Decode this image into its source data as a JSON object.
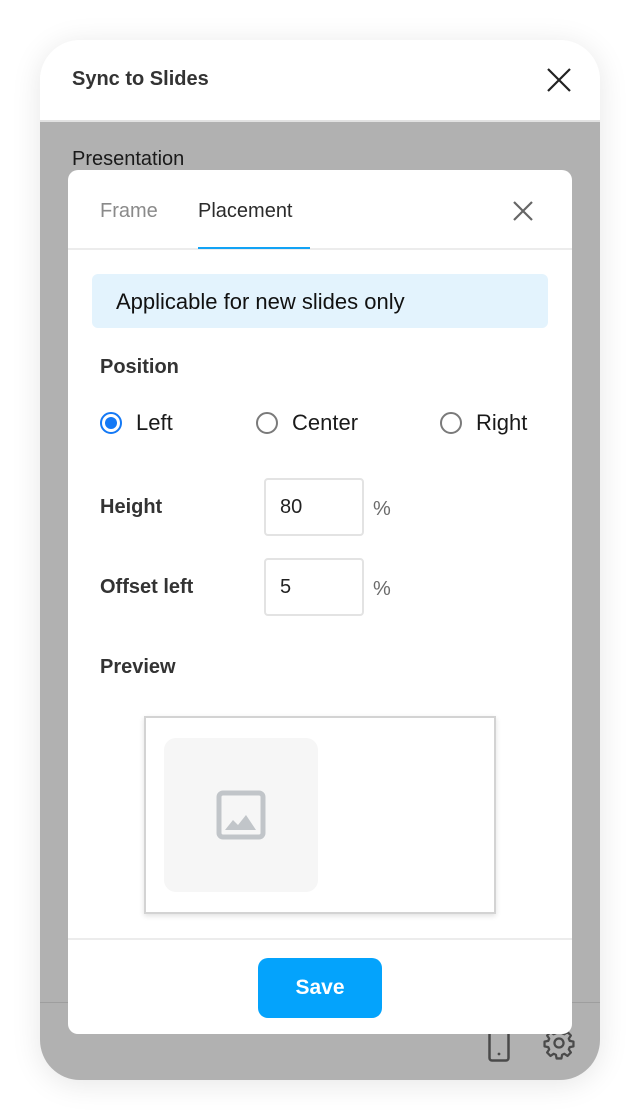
{
  "panel": {
    "title": "Sync to Slides",
    "close_icon": "close-icon",
    "body": {
      "presentation_label": "Presentation"
    },
    "footer": {
      "icons": [
        "phone-icon",
        "gear-icon"
      ]
    }
  },
  "modal": {
    "tabs": [
      {
        "label": "Frame",
        "active": false
      },
      {
        "label": "Placement",
        "active": true
      }
    ],
    "close_icon": "close-icon",
    "notice": "Applicable for new slides only",
    "position": {
      "label": "Position",
      "options": [
        {
          "label": "Left",
          "checked": true
        },
        {
          "label": "Center",
          "checked": false
        },
        {
          "label": "Right",
          "checked": false
        }
      ]
    },
    "height": {
      "label": "Height",
      "value": "80",
      "unit": "%"
    },
    "offset_left": {
      "label": "Offset left",
      "value": "5",
      "unit": "%"
    },
    "preview": {
      "label": "Preview",
      "icon": "image-icon"
    },
    "save_label": "Save"
  },
  "colors": {
    "accent": "#04a3fc",
    "tab_underline": "#12a3f5",
    "radio_checked": "#1479f5",
    "notice_bg": "#e3f3fd",
    "overlay_bg": "#b1b1b1"
  }
}
